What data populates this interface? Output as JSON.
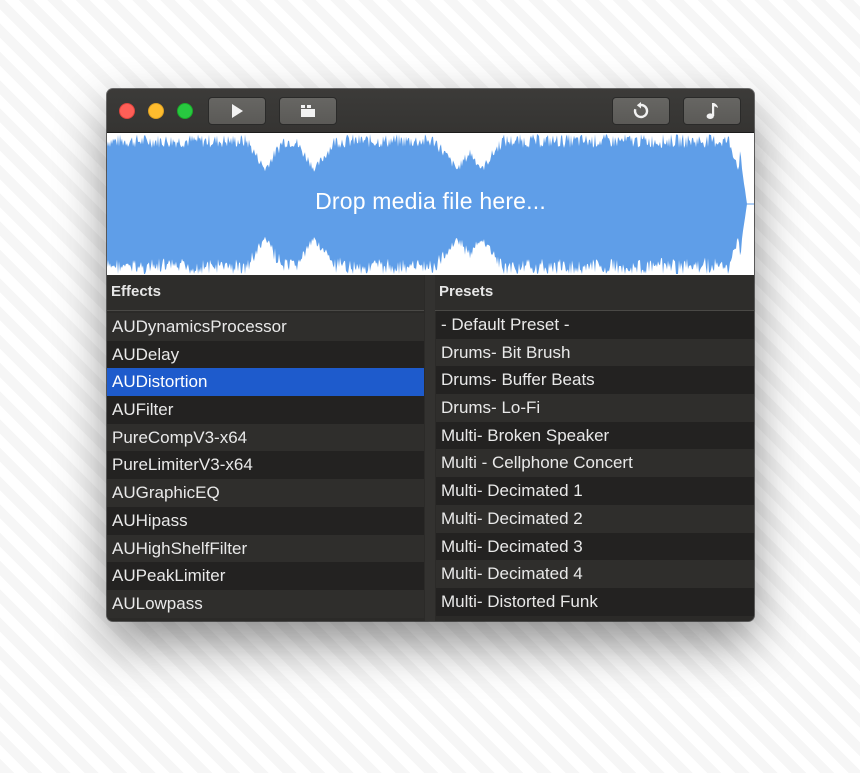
{
  "toolbar": {
    "buttons": [
      {
        "name": "play",
        "icon": "play-icon"
      },
      {
        "name": "clip",
        "icon": "clapper-icon"
      },
      {
        "name": "loop",
        "icon": "loop-icon"
      },
      {
        "name": "music",
        "icon": "music-note-icon"
      }
    ]
  },
  "waveform": {
    "drop_label": "Drop media file here...",
    "color": "#5f9ee8"
  },
  "effects": {
    "header": "Effects",
    "items": [
      {
        "label": "AUDynamicsProcessor",
        "selected": false
      },
      {
        "label": "AUDelay",
        "selected": false
      },
      {
        "label": "AUDistortion",
        "selected": true
      },
      {
        "label": "AUFilter",
        "selected": false
      },
      {
        "label": "PureCompV3-x64",
        "selected": false
      },
      {
        "label": "PureLimiterV3-x64",
        "selected": false
      },
      {
        "label": "AUGraphicEQ",
        "selected": false
      },
      {
        "label": "AUHipass",
        "selected": false
      },
      {
        "label": "AUHighShelfFilter",
        "selected": false
      },
      {
        "label": "AUPeakLimiter",
        "selected": false
      },
      {
        "label": "AULowpass",
        "selected": false
      }
    ]
  },
  "presets": {
    "header": "Presets",
    "items": [
      "- Default Preset -",
      "Drums- Bit Brush",
      "Drums- Buffer Beats",
      "Drums- Lo-Fi",
      "Multi- Broken Speaker",
      "Multi - Cellphone Concert",
      "Multi- Decimated 1",
      "Multi- Decimated 2",
      "Multi- Decimated 3",
      "Multi- Decimated 4",
      "Multi- Distorted Funk"
    ]
  },
  "colors": {
    "selection": "#1e5bcc",
    "window_bg": "#2b2a28"
  }
}
